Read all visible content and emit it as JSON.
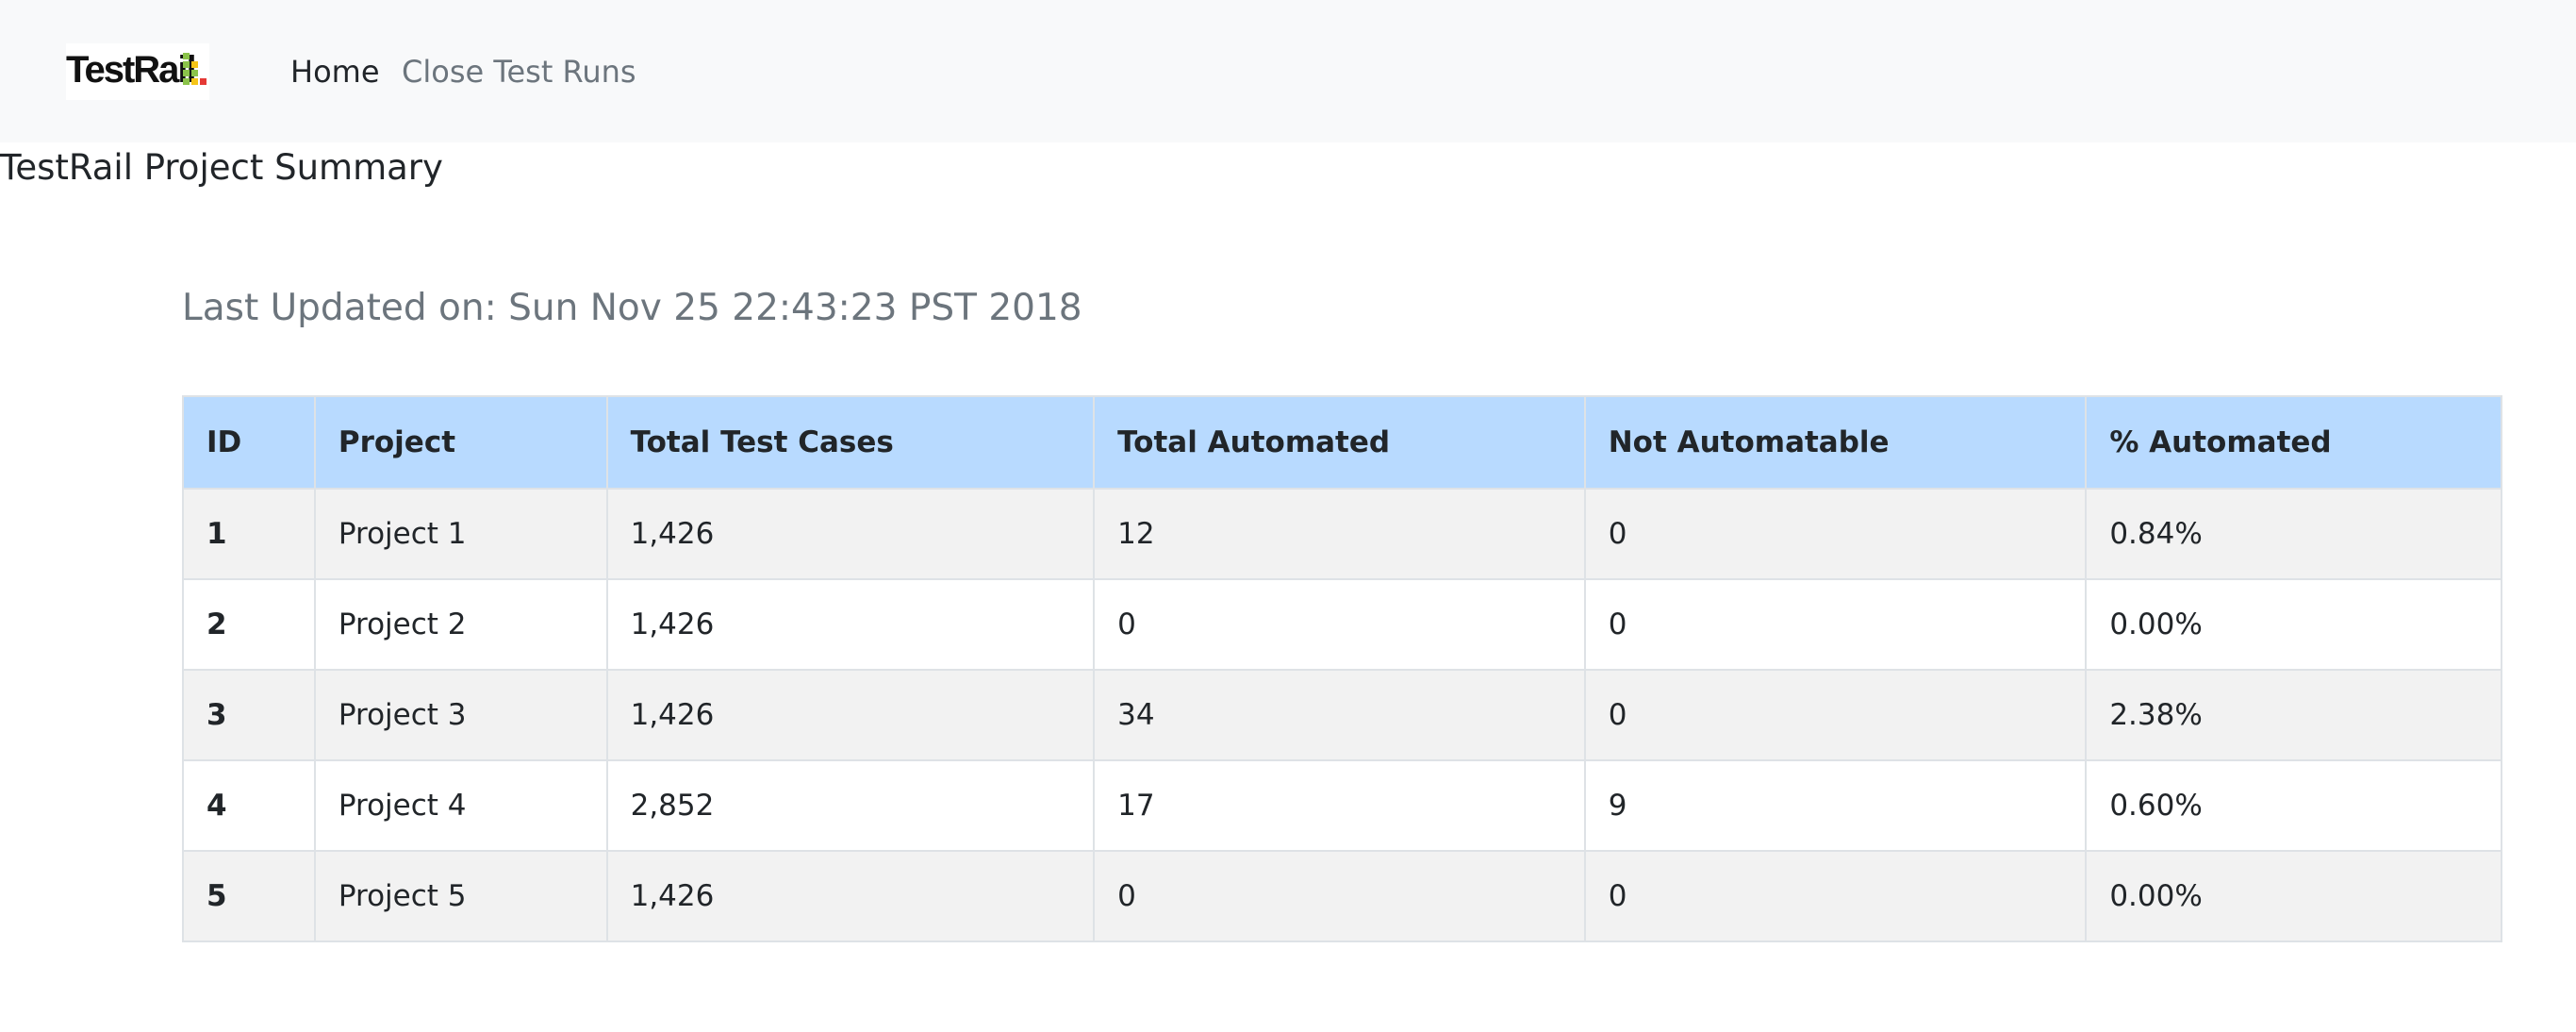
{
  "navbar": {
    "logo_text": "TestRail",
    "links": [
      {
        "label": "Home"
      },
      {
        "label": "Close Test Runs"
      }
    ]
  },
  "page": {
    "title": "TestRail Project Summary",
    "last_updated_label": "Last Updated on:",
    "last_updated_value": "Sun Nov 25 22:43:23 PST 2018"
  },
  "table": {
    "headers": [
      "ID",
      "Project",
      "Total Test Cases",
      "Total Automated",
      "Not Automatable",
      "% Automated"
    ],
    "rows": [
      [
        "1",
        "Project 1",
        "1,426",
        "12",
        "0",
        "0.84%"
      ],
      [
        "2",
        "Project 2",
        "1,426",
        "0",
        "0",
        "0.00%"
      ],
      [
        "3",
        "Project 3",
        "1,426",
        "34",
        "0",
        "2.38%"
      ],
      [
        "4",
        "Project 4",
        "2,852",
        "17",
        "9",
        "0.60%"
      ],
      [
        "5",
        "Project 5",
        "1,426",
        "0",
        "0",
        "0.00%"
      ]
    ]
  },
  "colors": {
    "navbar_bg": "#f8f9fa",
    "header_bg": "#b8daff",
    "stripe_bg": "#f2f2f2",
    "muted_text": "#6c757d",
    "logo_green": "#8bc34a",
    "logo_yellow": "#f5c518",
    "logo_red": "#e53935"
  }
}
